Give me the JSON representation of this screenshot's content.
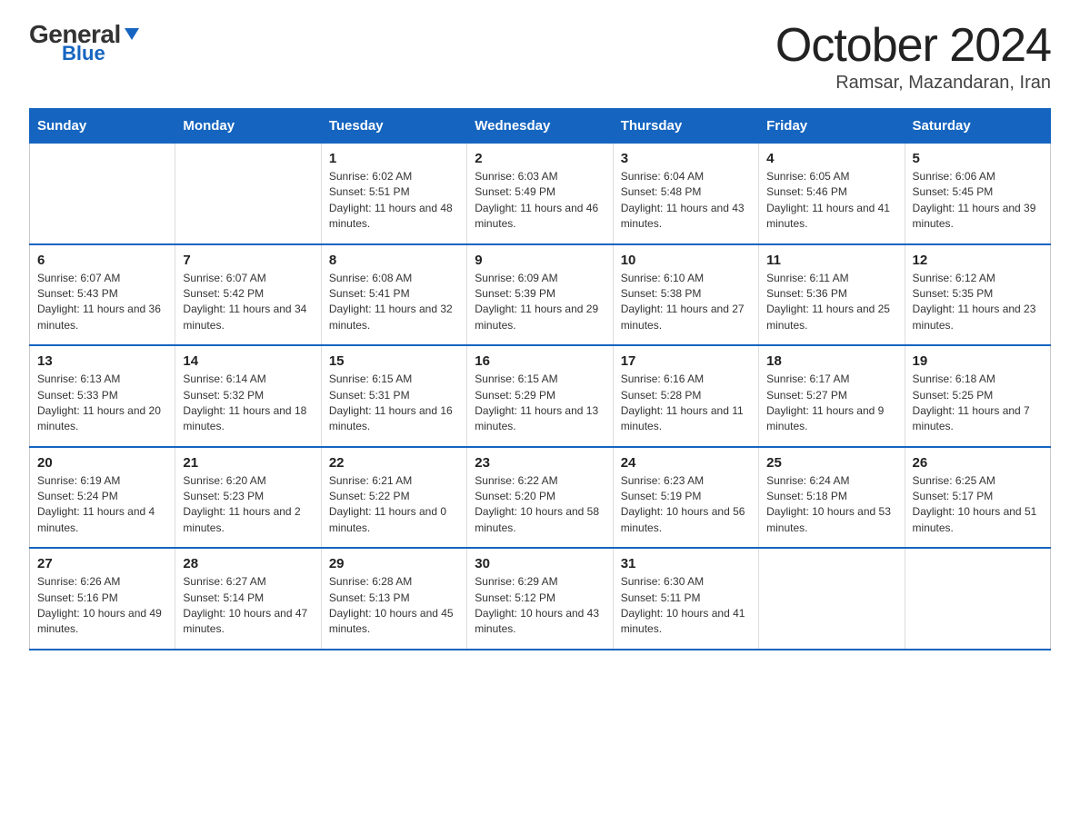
{
  "logo": {
    "top": "General",
    "arrow": "▶",
    "bottom": "Blue"
  },
  "title": {
    "month": "October 2024",
    "location": "Ramsar, Mazandaran, Iran"
  },
  "headers": [
    "Sunday",
    "Monday",
    "Tuesday",
    "Wednesday",
    "Thursday",
    "Friday",
    "Saturday"
  ],
  "weeks": [
    [
      {
        "day": "",
        "sunrise": "",
        "sunset": "",
        "daylight": ""
      },
      {
        "day": "",
        "sunrise": "",
        "sunset": "",
        "daylight": ""
      },
      {
        "day": "1",
        "sunrise": "Sunrise: 6:02 AM",
        "sunset": "Sunset: 5:51 PM",
        "daylight": "Daylight: 11 hours and 48 minutes."
      },
      {
        "day": "2",
        "sunrise": "Sunrise: 6:03 AM",
        "sunset": "Sunset: 5:49 PM",
        "daylight": "Daylight: 11 hours and 46 minutes."
      },
      {
        "day": "3",
        "sunrise": "Sunrise: 6:04 AM",
        "sunset": "Sunset: 5:48 PM",
        "daylight": "Daylight: 11 hours and 43 minutes."
      },
      {
        "day": "4",
        "sunrise": "Sunrise: 6:05 AM",
        "sunset": "Sunset: 5:46 PM",
        "daylight": "Daylight: 11 hours and 41 minutes."
      },
      {
        "day": "5",
        "sunrise": "Sunrise: 6:06 AM",
        "sunset": "Sunset: 5:45 PM",
        "daylight": "Daylight: 11 hours and 39 minutes."
      }
    ],
    [
      {
        "day": "6",
        "sunrise": "Sunrise: 6:07 AM",
        "sunset": "Sunset: 5:43 PM",
        "daylight": "Daylight: 11 hours and 36 minutes."
      },
      {
        "day": "7",
        "sunrise": "Sunrise: 6:07 AM",
        "sunset": "Sunset: 5:42 PM",
        "daylight": "Daylight: 11 hours and 34 minutes."
      },
      {
        "day": "8",
        "sunrise": "Sunrise: 6:08 AM",
        "sunset": "Sunset: 5:41 PM",
        "daylight": "Daylight: 11 hours and 32 minutes."
      },
      {
        "day": "9",
        "sunrise": "Sunrise: 6:09 AM",
        "sunset": "Sunset: 5:39 PM",
        "daylight": "Daylight: 11 hours and 29 minutes."
      },
      {
        "day": "10",
        "sunrise": "Sunrise: 6:10 AM",
        "sunset": "Sunset: 5:38 PM",
        "daylight": "Daylight: 11 hours and 27 minutes."
      },
      {
        "day": "11",
        "sunrise": "Sunrise: 6:11 AM",
        "sunset": "Sunset: 5:36 PM",
        "daylight": "Daylight: 11 hours and 25 minutes."
      },
      {
        "day": "12",
        "sunrise": "Sunrise: 6:12 AM",
        "sunset": "Sunset: 5:35 PM",
        "daylight": "Daylight: 11 hours and 23 minutes."
      }
    ],
    [
      {
        "day": "13",
        "sunrise": "Sunrise: 6:13 AM",
        "sunset": "Sunset: 5:33 PM",
        "daylight": "Daylight: 11 hours and 20 minutes."
      },
      {
        "day": "14",
        "sunrise": "Sunrise: 6:14 AM",
        "sunset": "Sunset: 5:32 PM",
        "daylight": "Daylight: 11 hours and 18 minutes."
      },
      {
        "day": "15",
        "sunrise": "Sunrise: 6:15 AM",
        "sunset": "Sunset: 5:31 PM",
        "daylight": "Daylight: 11 hours and 16 minutes."
      },
      {
        "day": "16",
        "sunrise": "Sunrise: 6:15 AM",
        "sunset": "Sunset: 5:29 PM",
        "daylight": "Daylight: 11 hours and 13 minutes."
      },
      {
        "day": "17",
        "sunrise": "Sunrise: 6:16 AM",
        "sunset": "Sunset: 5:28 PM",
        "daylight": "Daylight: 11 hours and 11 minutes."
      },
      {
        "day": "18",
        "sunrise": "Sunrise: 6:17 AM",
        "sunset": "Sunset: 5:27 PM",
        "daylight": "Daylight: 11 hours and 9 minutes."
      },
      {
        "day": "19",
        "sunrise": "Sunrise: 6:18 AM",
        "sunset": "Sunset: 5:25 PM",
        "daylight": "Daylight: 11 hours and 7 minutes."
      }
    ],
    [
      {
        "day": "20",
        "sunrise": "Sunrise: 6:19 AM",
        "sunset": "Sunset: 5:24 PM",
        "daylight": "Daylight: 11 hours and 4 minutes."
      },
      {
        "day": "21",
        "sunrise": "Sunrise: 6:20 AM",
        "sunset": "Sunset: 5:23 PM",
        "daylight": "Daylight: 11 hours and 2 minutes."
      },
      {
        "day": "22",
        "sunrise": "Sunrise: 6:21 AM",
        "sunset": "Sunset: 5:22 PM",
        "daylight": "Daylight: 11 hours and 0 minutes."
      },
      {
        "day": "23",
        "sunrise": "Sunrise: 6:22 AM",
        "sunset": "Sunset: 5:20 PM",
        "daylight": "Daylight: 10 hours and 58 minutes."
      },
      {
        "day": "24",
        "sunrise": "Sunrise: 6:23 AM",
        "sunset": "Sunset: 5:19 PM",
        "daylight": "Daylight: 10 hours and 56 minutes."
      },
      {
        "day": "25",
        "sunrise": "Sunrise: 6:24 AM",
        "sunset": "Sunset: 5:18 PM",
        "daylight": "Daylight: 10 hours and 53 minutes."
      },
      {
        "day": "26",
        "sunrise": "Sunrise: 6:25 AM",
        "sunset": "Sunset: 5:17 PM",
        "daylight": "Daylight: 10 hours and 51 minutes."
      }
    ],
    [
      {
        "day": "27",
        "sunrise": "Sunrise: 6:26 AM",
        "sunset": "Sunset: 5:16 PM",
        "daylight": "Daylight: 10 hours and 49 minutes."
      },
      {
        "day": "28",
        "sunrise": "Sunrise: 6:27 AM",
        "sunset": "Sunset: 5:14 PM",
        "daylight": "Daylight: 10 hours and 47 minutes."
      },
      {
        "day": "29",
        "sunrise": "Sunrise: 6:28 AM",
        "sunset": "Sunset: 5:13 PM",
        "daylight": "Daylight: 10 hours and 45 minutes."
      },
      {
        "day": "30",
        "sunrise": "Sunrise: 6:29 AM",
        "sunset": "Sunset: 5:12 PM",
        "daylight": "Daylight: 10 hours and 43 minutes."
      },
      {
        "day": "31",
        "sunrise": "Sunrise: 6:30 AM",
        "sunset": "Sunset: 5:11 PM",
        "daylight": "Daylight: 10 hours and 41 minutes."
      },
      {
        "day": "",
        "sunrise": "",
        "sunset": "",
        "daylight": ""
      },
      {
        "day": "",
        "sunrise": "",
        "sunset": "",
        "daylight": ""
      }
    ]
  ]
}
